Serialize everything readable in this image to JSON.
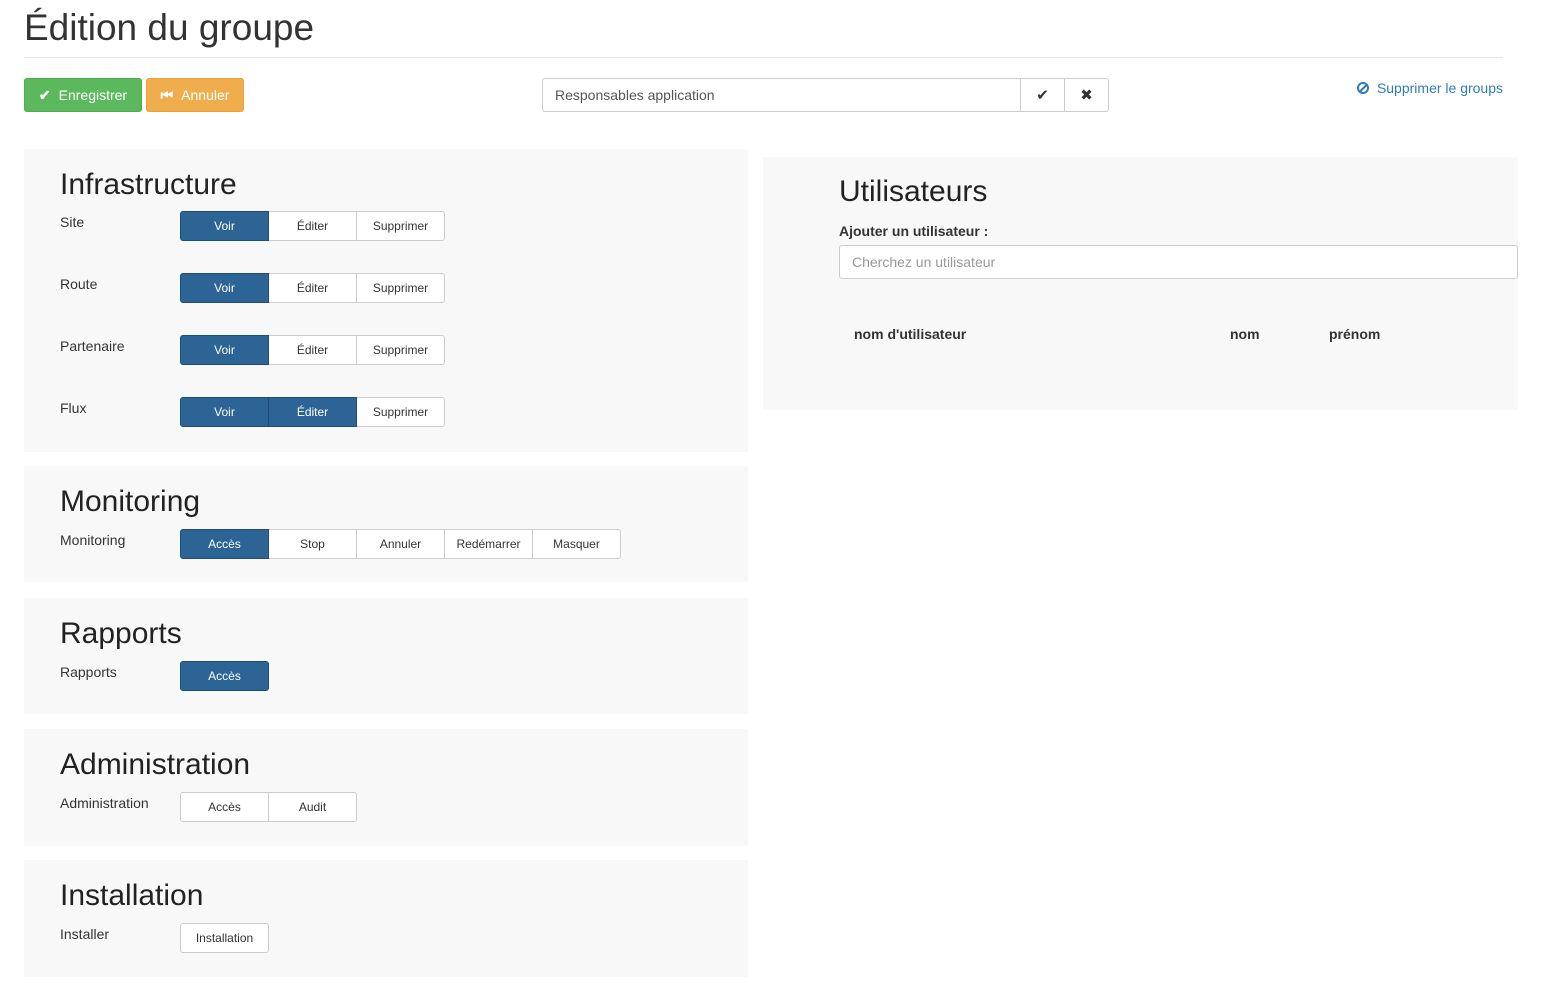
{
  "page": {
    "title": "Édition du groupe"
  },
  "toolbar": {
    "save_label": "Enregistrer",
    "cancel_label": "Annuler",
    "group_name_value": "Responsables application",
    "confirm_icon": "check-icon",
    "clear_icon": "times-icon",
    "delete_link_label": "Supprimer le groups"
  },
  "sections": {
    "infrastructure": {
      "title": "Infrastructure",
      "rows": [
        {
          "label": "Site",
          "buttons": [
            {
              "label": "Voir",
              "active": true
            },
            {
              "label": "Éditer",
              "active": false
            },
            {
              "label": "Supprimer",
              "active": false
            }
          ]
        },
        {
          "label": "Route",
          "buttons": [
            {
              "label": "Voir",
              "active": true
            },
            {
              "label": "Éditer",
              "active": false
            },
            {
              "label": "Supprimer",
              "active": false
            }
          ]
        },
        {
          "label": "Partenaire",
          "buttons": [
            {
              "label": "Voir",
              "active": true
            },
            {
              "label": "Éditer",
              "active": false
            },
            {
              "label": "Supprimer",
              "active": false
            }
          ]
        },
        {
          "label": "Flux",
          "buttons": [
            {
              "label": "Voir",
              "active": true
            },
            {
              "label": "Éditer",
              "active": true
            },
            {
              "label": "Supprimer",
              "active": false
            }
          ]
        }
      ]
    },
    "monitoring": {
      "title": "Monitoring",
      "rows": [
        {
          "label": "Monitoring",
          "buttons": [
            {
              "label": "Accès",
              "active": true
            },
            {
              "label": "Stop",
              "active": false
            },
            {
              "label": "Annuler",
              "active": false
            },
            {
              "label": "Redémarrer",
              "active": false
            },
            {
              "label": "Masquer",
              "active": false
            }
          ]
        }
      ]
    },
    "rapports": {
      "title": "Rapports",
      "rows": [
        {
          "label": "Rapports",
          "buttons": [
            {
              "label": "Accès",
              "active": true
            }
          ]
        }
      ]
    },
    "administration": {
      "title": "Administration",
      "rows": [
        {
          "label": "Administration",
          "buttons": [
            {
              "label": "Accès",
              "active": false
            },
            {
              "label": "Audit",
              "active": false
            }
          ]
        }
      ]
    },
    "installation": {
      "title": "Installation",
      "rows": [
        {
          "label": "Installer",
          "buttons": [
            {
              "label": "Installation",
              "active": false
            }
          ]
        }
      ]
    }
  },
  "users": {
    "title": "Utilisateurs",
    "add_label": "Ajouter un utilisateur :",
    "search_placeholder": "Cherchez un utilisateur",
    "columns": [
      "nom d'utilisateur",
      "nom",
      "prénom"
    ]
  },
  "colors": {
    "save": "#5cb85c",
    "cancel": "#f0ad4e",
    "active_toggle": "#2d6496",
    "link": "#337ab7",
    "panel_bg": "#f8f8f8"
  }
}
